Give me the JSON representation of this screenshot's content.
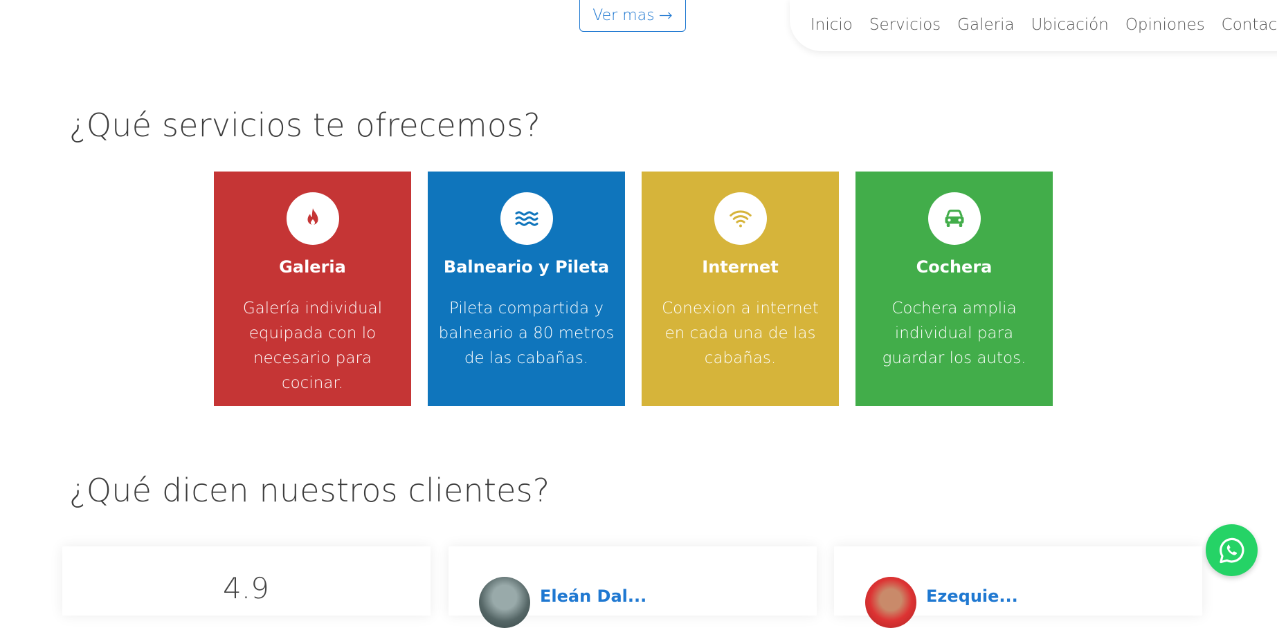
{
  "hero": {
    "ver_mas_label": "Ver mas",
    "ver_mas_arrow": "→"
  },
  "nav": {
    "items": [
      "Inicio",
      "Servicios",
      "Galeria",
      "Ubicación",
      "Opiniones",
      "Contacto"
    ]
  },
  "services": {
    "title": "¿Qué servicios te ofrecemos?",
    "cards": [
      {
        "title": "Galeria",
        "text": "Galería individual equipada con lo necesario para cocinar.",
        "icon": "fire-icon",
        "color": "#c53535"
      },
      {
        "title": "Balneario y Pileta",
        "text": "Pileta compartida y balneario a 80 metros de las cabañas.",
        "icon": "water-icon",
        "color": "#0f75bc"
      },
      {
        "title": "Internet",
        "text": "Conexion a internet en cada una de las cabañas.",
        "icon": "wifi-icon",
        "color": "#d6b43a"
      },
      {
        "title": "Cochera",
        "text": "Cochera amplia individual para guardar los autos.",
        "icon": "car-icon",
        "color": "#42ad4a"
      }
    ]
  },
  "testimonials": {
    "title": "¿Qué dicen nuestros clientes?",
    "rating": "4.9",
    "reviewers": [
      "Eleán Dal...",
      "Ezequie..."
    ]
  },
  "whatsapp": {
    "icon": "whatsapp-icon",
    "color": "#25d366"
  }
}
